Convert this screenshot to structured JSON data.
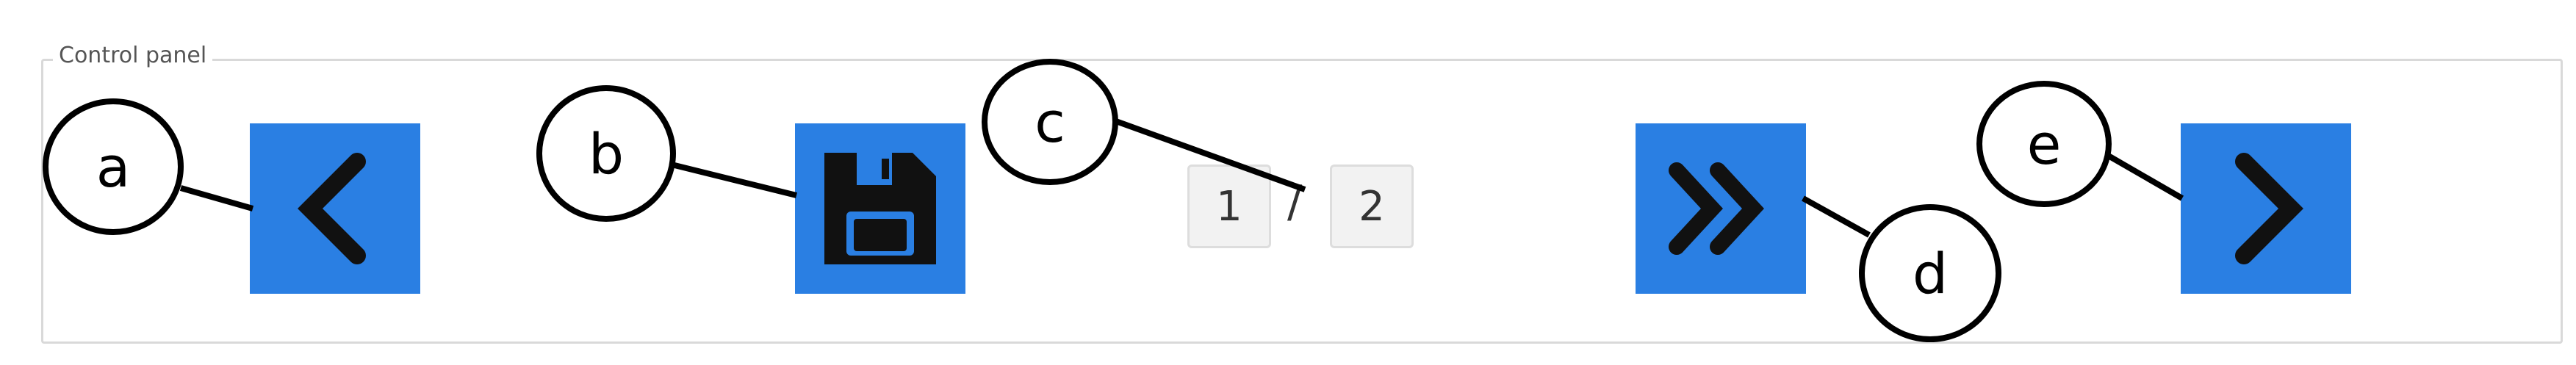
{
  "panel": {
    "legend": "Control panel"
  },
  "buttons": {
    "previous": {
      "icon": "chevron-left-icon"
    },
    "save": {
      "icon": "floppy-disk-icon"
    },
    "fast_forward": {
      "icon": "double-chevron-right-icon"
    },
    "next": {
      "icon": "chevron-right-icon"
    }
  },
  "pagination": {
    "current_page": "1",
    "separator": "/",
    "total_pages": "2"
  },
  "callouts": {
    "a": "a",
    "b": "b",
    "c": "c",
    "d": "d",
    "e": "e"
  },
  "colors": {
    "button_blue": "#2a7fe3",
    "icon_dark": "#111111"
  }
}
